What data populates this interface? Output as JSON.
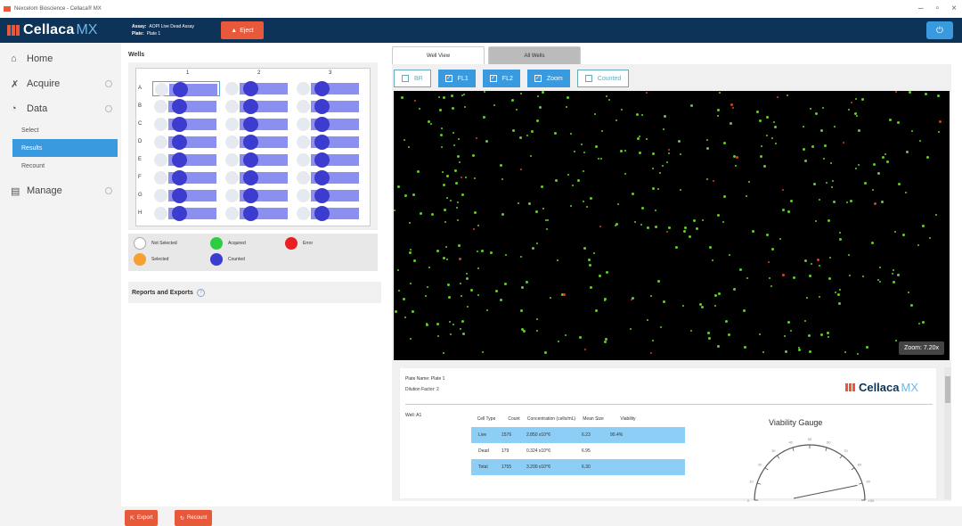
{
  "window": {
    "title": "Nexcelom Bioscience - Cellaca® MX",
    "controls": [
      "–",
      "▫",
      "×"
    ]
  },
  "header": {
    "brand": "Cellaca",
    "brand_suffix": "MX",
    "assay_label": "Assay:",
    "assay_value": "AOPI Live Dead Assay",
    "plate_label": "Plate:",
    "plate_value": "Plate 1",
    "eject_label": "Eject",
    "power_icon": "power-icon"
  },
  "sidebar": {
    "home": "Home",
    "acquire": "Acquire",
    "data": "Data",
    "data_sub": [
      "Select",
      "Results",
      "Recount"
    ],
    "manage": "Manage"
  },
  "wells": {
    "title": "Wells",
    "columns": [
      "1",
      "2",
      "3"
    ],
    "rows": [
      "A",
      "B",
      "C",
      "D",
      "E",
      "F",
      "G",
      "H"
    ],
    "legend": {
      "not_selected": "Not Selected",
      "acquired": "Acquired",
      "error": "Error",
      "selected": "Selected",
      "counted": "Counted"
    }
  },
  "reports": {
    "title": "Reports and Exports"
  },
  "view": {
    "tabs": [
      "Well View",
      "All Wells"
    ],
    "chips": [
      "BR",
      "FL1",
      "FL2",
      "Zoom",
      "Counted"
    ],
    "zoom": "Zoom: 7.20x"
  },
  "results": {
    "plate_name": "Plate Name: Plate 1",
    "dilution": "Dilution Factor: 2",
    "well": "Well: A1",
    "brand": "Cellaca",
    "brand_suffix": "MX",
    "headers": [
      "Cell Type",
      "Count",
      "Concentration (cells/mL)",
      "Mean Size",
      "Viability"
    ],
    "rows": [
      {
        "type": "Live",
        "count": "1576",
        "conc": "2.850 x10^6",
        "size": "6.23",
        "viab": "90.4%"
      },
      {
        "type": "Dead",
        "count": "179",
        "conc": "0.324 x10^6",
        "size": "6.95",
        "viab": ""
      },
      {
        "type": "Total",
        "count": "1755",
        "conc": "3.200 x10^6",
        "size": "6.30",
        "viab": ""
      }
    ],
    "gauge_title": "Viability Gauge",
    "viability_value": 90.4,
    "gauge_ticks": [
      "0",
      "10",
      "20",
      "30",
      "40",
      "50",
      "60",
      "70",
      "80",
      "90",
      "100"
    ]
  },
  "bottom": {
    "export_label": "Export",
    "recount_label": "Recount"
  },
  "colors": {
    "header_bg": "#0d3358",
    "accent_orange": "#e8583a",
    "accent_blue": "#3a9ae0",
    "well_counted": "#3c3cd0",
    "acquired": "#2ecc40",
    "error": "#e82020",
    "selected": "#f5a030"
  }
}
